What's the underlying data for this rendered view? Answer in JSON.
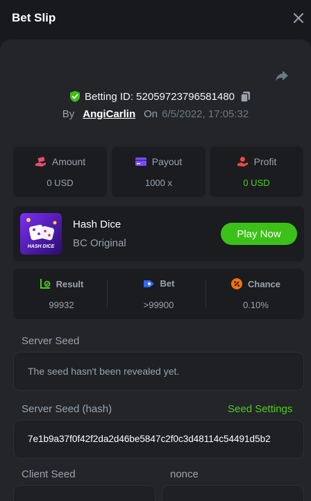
{
  "header": {
    "title": "Bet Slip",
    "close_icon": "close-icon"
  },
  "bet": {
    "id_text": "Betting ID: 52059723796581480",
    "by_label": "By",
    "user": "AngiCarlin",
    "on_label": "On",
    "date": "6/5/2022, 17:05:32"
  },
  "stats": {
    "amount": {
      "label": "Amount",
      "value": "0 USD"
    },
    "payout": {
      "label": "Payout",
      "value": "1000 x"
    },
    "profit": {
      "label": "Profit",
      "value": "0 USD"
    }
  },
  "game": {
    "name": "Hash Dice",
    "provider": "BC Original",
    "play_label": "Play Now",
    "thumb_caption": "HASH DICE"
  },
  "result": {
    "result": {
      "label": "Result",
      "value": "99932"
    },
    "bet": {
      "label": "Bet",
      "value": ">99900"
    },
    "chance": {
      "label": "Chance",
      "value": "0.10%"
    }
  },
  "server_seed": {
    "label": "Server Seed",
    "value": "The seed hasn't been revealed yet."
  },
  "server_seed_hash": {
    "label": "Server Seed (hash)",
    "settings_label": "Seed Settings",
    "value": "7e1b9a37f0f42f2da2d46be5847c2f0c3d48114c54491d5b2"
  },
  "client_seed": {
    "label": "Client Seed"
  },
  "nonce": {
    "label": "nonce"
  },
  "colors": {
    "accent": "#3bc117",
    "profit": "#4fce1e",
    "panel": "#232528",
    "card": "#1b1c1f"
  }
}
